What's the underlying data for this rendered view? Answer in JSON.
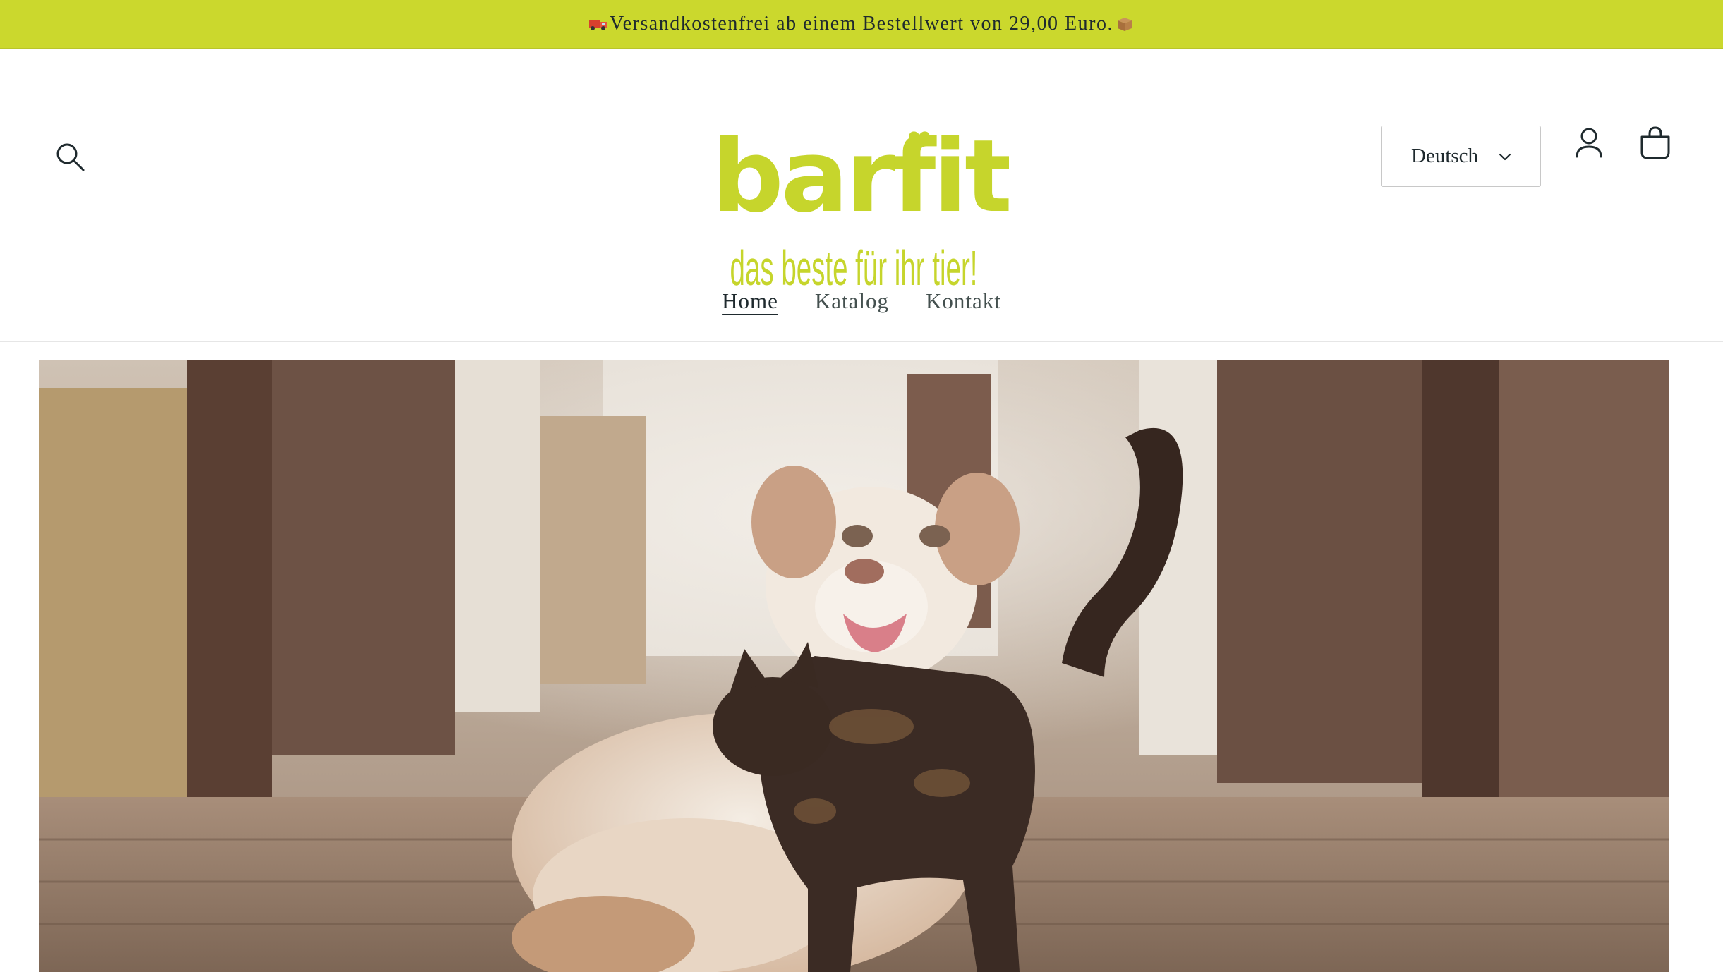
{
  "announcement": {
    "text": "Versandkostenfrei ab einem Bestellwert von 29,00 Euro.",
    "leading_icon": "truck-emoji",
    "trailing_icon": "package-emoji"
  },
  "header": {
    "logo": {
      "brand": "barfit",
      "tagline": "das beste für ihr tier!"
    },
    "language_select": {
      "selected": "Deutsch"
    },
    "icons": [
      "search-icon",
      "account-icon",
      "cart-icon"
    ]
  },
  "nav": {
    "items": [
      {
        "label": "Home",
        "active": true
      },
      {
        "label": "Katalog",
        "active": false
      },
      {
        "label": "Kontakt",
        "active": false
      }
    ]
  },
  "hero": {
    "image": "dog-and-cat-in-barn-photo"
  },
  "colors": {
    "accent": "#cbd82d",
    "text": "#1f2a2e"
  }
}
